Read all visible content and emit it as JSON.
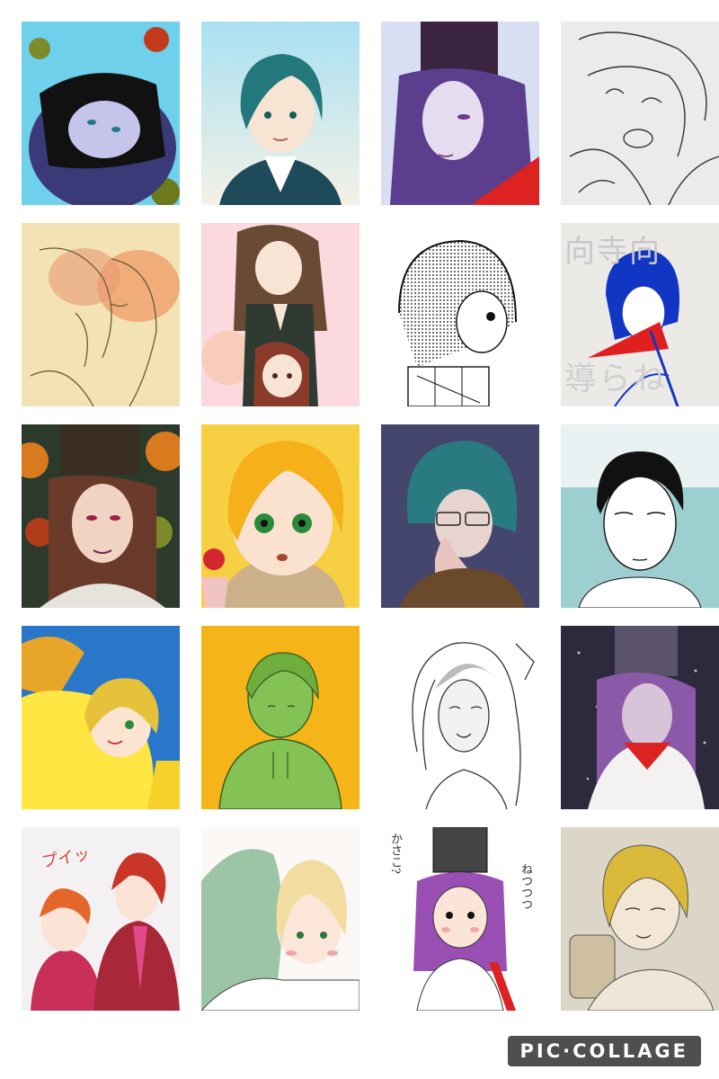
{
  "collage": {
    "tiles": [
      {
        "title": "",
        "theme": "dark-haired youth under autumn maple leaves"
      },
      {
        "title": "",
        "theme": "teal-haired youth in blazer"
      },
      {
        "title": "",
        "theme": "long purple hair with black court hat"
      },
      {
        "title": "",
        "theme": "pencil sketch, laughing character"
      },
      {
        "title": "",
        "theme": "sketch of two figures kissing, orange tone"
      },
      {
        "title": "",
        "theme": "older girl brushing younger girl's hair"
      },
      {
        "title": "",
        "theme": "screentone manga bob-haired girl"
      },
      {
        "title": "",
        "theme": "blue ink figure with kanji text"
      },
      {
        "title": "",
        "theme": "court noble with black hat among autumn leaves"
      },
      {
        "title": "",
        "theme": "blond boy with green eyes eating cake"
      },
      {
        "title": "",
        "theme": "teal-haired girl with glasses"
      },
      {
        "title": "",
        "theme": "monochrome white-haired youth on mint background"
      },
      {
        "title": "",
        "theme": "blond youth in yellow on blue background"
      },
      {
        "title": "",
        "theme": "green boy in hoodie on orange background"
      },
      {
        "title": "",
        "theme": "line art long-haired character"
      },
      {
        "title": "",
        "theme": "court noble under night snowfall"
      },
      {
        "title": "",
        "theme": "two red-haired boys in suits"
      },
      {
        "title": "",
        "theme": "green-haired and blond characters embracing"
      },
      {
        "title": "",
        "theme": "chibi noble in black hat with red hakama"
      },
      {
        "title": "",
        "theme": "blond youth holding a cup"
      }
    ],
    "captions": {
      "tile8_kanji_top": "向寺向",
      "tile8_kanji_bottom": "導らね",
      "tile17_onomatopoeia": "プイッ",
      "tile19_line1": "かさこ?",
      "tile19_line2": "ねつつつ"
    }
  },
  "watermark": {
    "label": "PIC·COLLAGE"
  },
  "colors": {
    "background": "#ffffff",
    "watermark_bg": "#2b2b2b",
    "watermark_text": "#ffffff"
  }
}
